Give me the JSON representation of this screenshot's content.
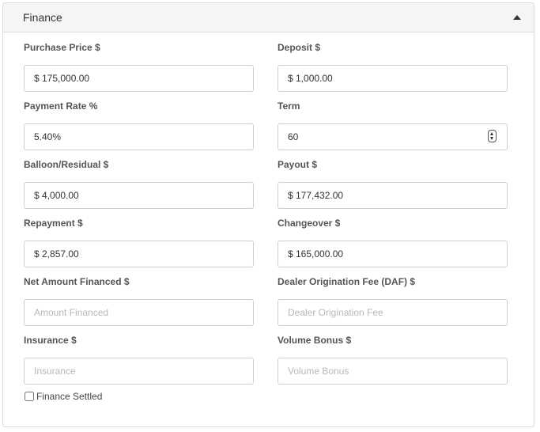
{
  "panel": {
    "title": "Finance"
  },
  "fields": {
    "purchase_price": {
      "label": "Purchase Price $",
      "value": "$ 175,000.00",
      "placeholder": ""
    },
    "deposit": {
      "label": "Deposit $",
      "value": "$ 1,000.00",
      "placeholder": ""
    },
    "payment_rate": {
      "label": "Payment Rate %",
      "value": "5.40%",
      "placeholder": ""
    },
    "term": {
      "label": "Term",
      "value": "60",
      "placeholder": ""
    },
    "balloon_residual": {
      "label": "Balloon/Residual $",
      "value": "$ 4,000.00",
      "placeholder": ""
    },
    "payout": {
      "label": "Payout $",
      "value": "$ 177,432.00",
      "placeholder": ""
    },
    "repayment": {
      "label": "Repayment $",
      "value": "$ 2,857.00",
      "placeholder": ""
    },
    "changeover": {
      "label": "Changeover $",
      "value": "$ 165,000.00",
      "placeholder": ""
    },
    "net_amount_financed": {
      "label": "Net Amount Financed $",
      "value": "",
      "placeholder": "Amount Financed"
    },
    "dealer_origination_fee": {
      "label": "Dealer Origination Fee (DAF) $",
      "value": "",
      "placeholder": "Dealer Origination Fee"
    },
    "insurance": {
      "label": "Insurance $",
      "value": "",
      "placeholder": "Insurance"
    },
    "volume_bonus": {
      "label": "Volume Bonus $",
      "value": "",
      "placeholder": "Volume Bonus"
    }
  },
  "finance_settled": {
    "label": "Finance Settled",
    "checked": false
  }
}
